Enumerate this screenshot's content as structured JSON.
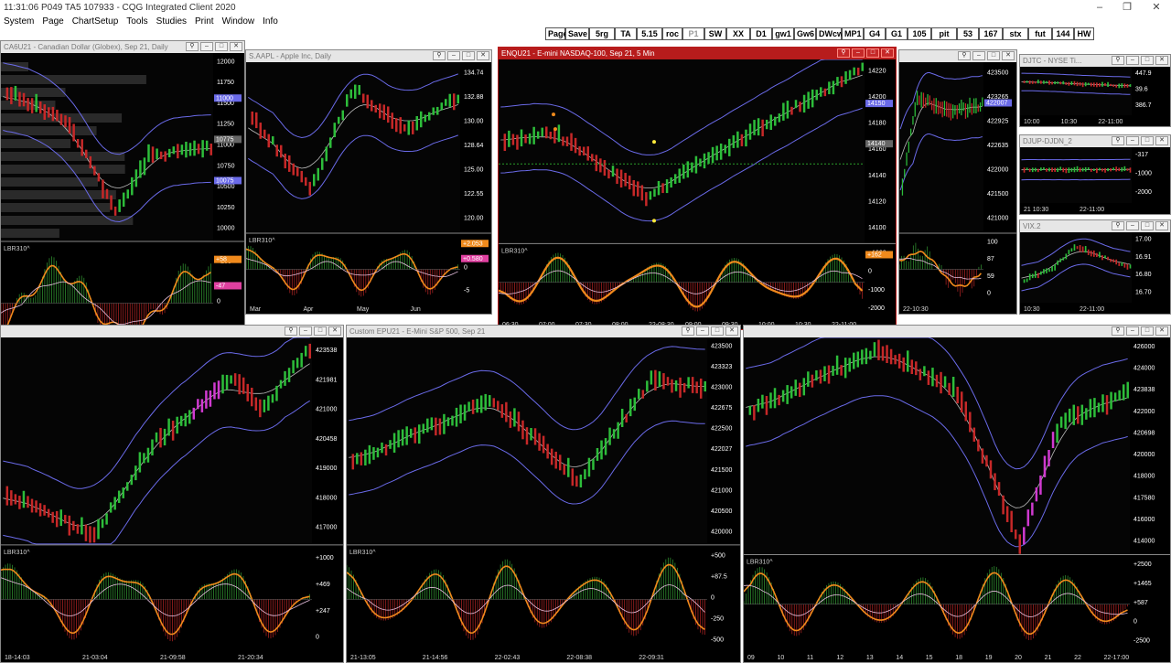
{
  "app": {
    "title": "11:31:06  P049 TA5  107933 - CQG Integrated Client 2020"
  },
  "menu": [
    "System",
    "Page",
    "ChartSetup",
    "Tools",
    "Studies",
    "Print",
    "Window",
    "Info"
  ],
  "toolbar": [
    "Page",
    "Save",
    "5rg",
    "TA",
    "5.15",
    "roc",
    "P1",
    "SW",
    "XX",
    "D1",
    "gw1",
    "Gw6",
    "DWcw",
    "MP1",
    "G4",
    "G1",
    "105",
    "pit",
    "53",
    "167",
    "stx",
    "fut",
    "144",
    "HW"
  ],
  "colors": {
    "accent": "#b71c1c",
    "up": "#2dbd3a",
    "down": "#c62828",
    "band": "#6a6ae8",
    "osc": "#f08a1c",
    "magenta": "#d03ad0"
  },
  "windows": [
    {
      "id": "w1",
      "title": "CA6U21 - Canadian Dollar (Globex), Sep 21, Daily",
      "axis": [
        "12000",
        "11750",
        "11500",
        "11250",
        "11000",
        "10750",
        "10500",
        "10250",
        "10000"
      ],
      "tags": [
        "11000",
        "10775",
        "10075"
      ],
      "study": "LBR310^",
      "study_axis": [
        "+250",
        "0",
        "-250"
      ],
      "study_tags": [
        "+58",
        "-47"
      ],
      "xaxis": [
        "17",
        "18",
        "21",
        "21-17:00"
      ]
    },
    {
      "id": "w2",
      "title": "S.AAPL - Apple Inc, Daily",
      "axis": [
        "134.74",
        "132.88",
        "130.00",
        "128.64",
        "125.00",
        "122.55",
        "120.00"
      ],
      "study": "LBR310^",
      "study_axis": [
        "+5",
        "0",
        "-5"
      ],
      "study_tags": [
        "+2.053",
        "+0.580"
      ],
      "xaxis": [
        "Mar",
        "Apr",
        "May",
        "Jun"
      ]
    },
    {
      "id": "w3",
      "title": "ENQU21 - E-mini NASDAQ-100, Sep 21, 5 Min",
      "axis": [
        "14220",
        "14200",
        "14180",
        "14160",
        "14140",
        "14120",
        "14100"
      ],
      "tags": [
        "14150",
        "14140"
      ],
      "study": "LBR310^",
      "study_axis": [
        "+1000",
        "0",
        "-1000",
        "-2000"
      ],
      "study_tags": [
        "+162"
      ],
      "xaxis": [
        "06:30",
        "07:00",
        "07:30",
        "08:00",
        "22-08:30",
        "09:00",
        "09:30",
        "10:00",
        "10:30",
        "22-11:00"
      ]
    },
    {
      "id": "w4",
      "title": "",
      "axis": [
        "423500",
        "423265",
        "422925",
        "422635",
        "422000",
        "421500",
        "421000"
      ],
      "tags": [
        "422007"
      ],
      "study_axis": [
        "100",
        "87",
        "59",
        "0"
      ],
      "xaxis": [
        "22-10:30"
      ]
    },
    {
      "id": "w5",
      "title": "DJTC - NYSE Ti...",
      "axis": [
        "447.9",
        "39.6",
        "386.7"
      ],
      "xaxis": [
        "10:00",
        "10:30",
        "22-11:00"
      ]
    },
    {
      "id": "w6",
      "title": "DJUP-DJDN_2",
      "axis": [
        "-317",
        "-1000",
        "-2000"
      ],
      "xaxis": [
        "21 10:30",
        "22-11:00"
      ]
    },
    {
      "id": "w7",
      "title": "VIX.2",
      "axis": [
        "17.00",
        "16.91",
        "16.80",
        "16.70"
      ],
      "xaxis": [
        "10:30",
        "22-11:00"
      ]
    },
    {
      "id": "w8",
      "title": "",
      "axis": [
        "423538",
        "421981",
        "421000",
        "420458",
        "419000",
        "418000",
        "417000"
      ],
      "study": "LBR310^",
      "study_axis": [
        "+1000",
        "+469",
        "+247",
        "0"
      ],
      "xaxis": [
        "18-14:03",
        "21-03:04",
        "21-09:58",
        "21-20:34"
      ]
    },
    {
      "id": "w9",
      "title": "Custom EPU21 - E-Mini S&P 500, Sep 21",
      "axis": [
        "423500",
        "423323",
        "423000",
        "422675",
        "422500",
        "422027",
        "421500",
        "421000",
        "420500",
        "420000"
      ],
      "study": "LBR310^",
      "study_axis": [
        "+500",
        "+87.5",
        "0",
        "-250",
        "-500"
      ],
      "xaxis": [
        "21-13:05",
        "21-14:56",
        "22-02:43",
        "22-08:38",
        "22-09:31"
      ]
    },
    {
      "id": "w10",
      "title": "",
      "axis": [
        "426000",
        "424000",
        "423838",
        "422000",
        "420698",
        "420000",
        "418000",
        "417580",
        "416000",
        "414000"
      ],
      "study": "LBR310^",
      "study_axis": [
        "+2500",
        "+1465",
        "+587",
        "0",
        "-2500"
      ],
      "xaxis": [
        "09",
        "10",
        "11",
        "12",
        "13",
        "14",
        "15",
        "18",
        "19",
        "20",
        "21",
        "22",
        "22-17:00"
      ]
    }
  ]
}
